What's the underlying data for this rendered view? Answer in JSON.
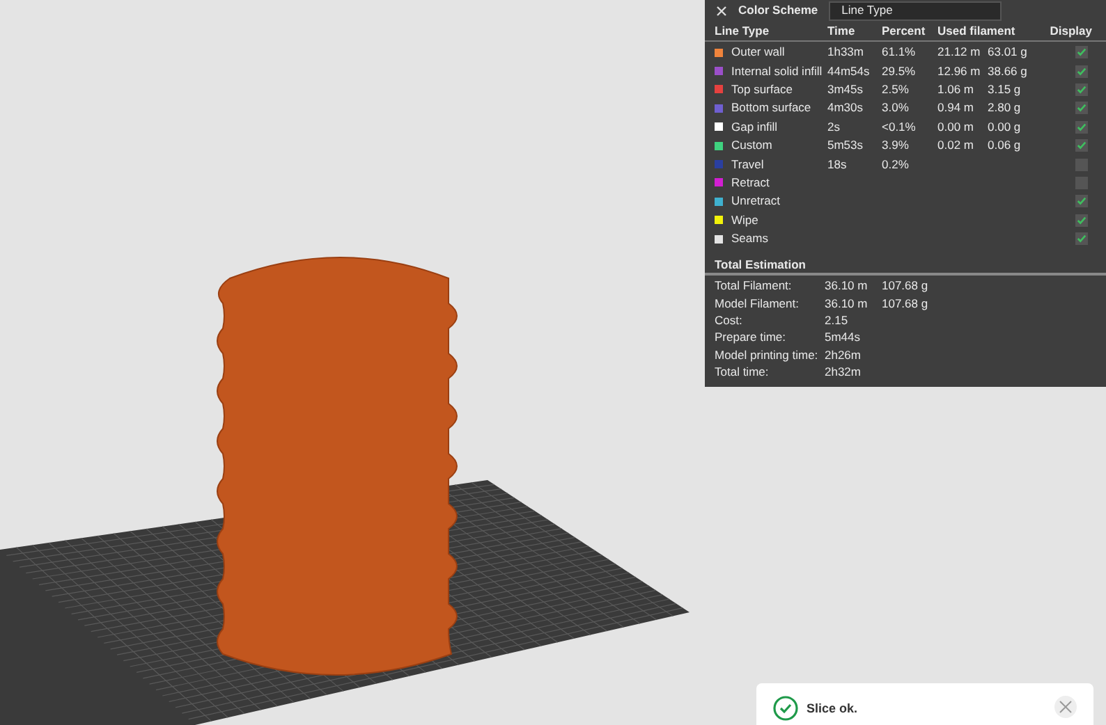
{
  "legend": {
    "title": "Color Scheme",
    "scheme": "Line Type",
    "columns": [
      "Line Type",
      "Time",
      "Percent",
      "Used filament",
      "Display"
    ],
    "rows": [
      {
        "name": "Outer wall",
        "color": "#f0843c",
        "time": "1h33m",
        "percent": "61.1%",
        "length": "21.12 m",
        "weight": "63.01 g",
        "checked": true
      },
      {
        "name": "Internal solid infill",
        "color": "#9b4fc9",
        "time": "44m54s",
        "percent": "29.5%",
        "length": "12.96 m",
        "weight": "38.66 g",
        "checked": true
      },
      {
        "name": "Top surface",
        "color": "#e6413f",
        "time": "3m45s",
        "percent": "2.5%",
        "length": "1.06 m",
        "weight": "3.15 g",
        "checked": true
      },
      {
        "name": "Bottom surface",
        "color": "#6f5fd0",
        "time": "4m30s",
        "percent": "3.0%",
        "length": "0.94 m",
        "weight": "2.80 g",
        "checked": true
      },
      {
        "name": "Gap infill",
        "color": "#ffffff",
        "time": "2s",
        "percent": "<0.1%",
        "length": "0.00 m",
        "weight": "0.00 g",
        "checked": true
      },
      {
        "name": "Custom",
        "color": "#3fd27f",
        "time": "5m53s",
        "percent": "3.9%",
        "length": "0.02 m",
        "weight": "0.06 g",
        "checked": true
      },
      {
        "name": "Travel",
        "color": "#2a3fa0",
        "time": "18s",
        "percent": "0.2%",
        "checked": false
      },
      {
        "name": "Retract",
        "color": "#d21fd2",
        "checked": false
      },
      {
        "name": "Unretract",
        "color": "#3fb1cf",
        "checked": true
      },
      {
        "name": "Wipe",
        "color": "#f2f20a",
        "checked": true
      },
      {
        "name": "Seams",
        "color": "#e4e4e4",
        "checked": true
      }
    ]
  },
  "estimation": {
    "title": "Total Estimation",
    "rows": [
      {
        "label": "Total Filament:",
        "value": "36.10 m",
        "value_2": "107.68 g"
      },
      {
        "label": "Model Filament:",
        "value": "36.10 m",
        "value_2": "107.68 g"
      },
      {
        "label": "Cost:",
        "value": "2.15"
      },
      {
        "label": "Prepare time:",
        "value": "5m44s"
      },
      {
        "label": "Model printing time:",
        "value": "2h26m"
      },
      {
        "label": "Total time:",
        "value": "2h32m"
      }
    ]
  },
  "toast": {
    "message": "Slice ok."
  }
}
